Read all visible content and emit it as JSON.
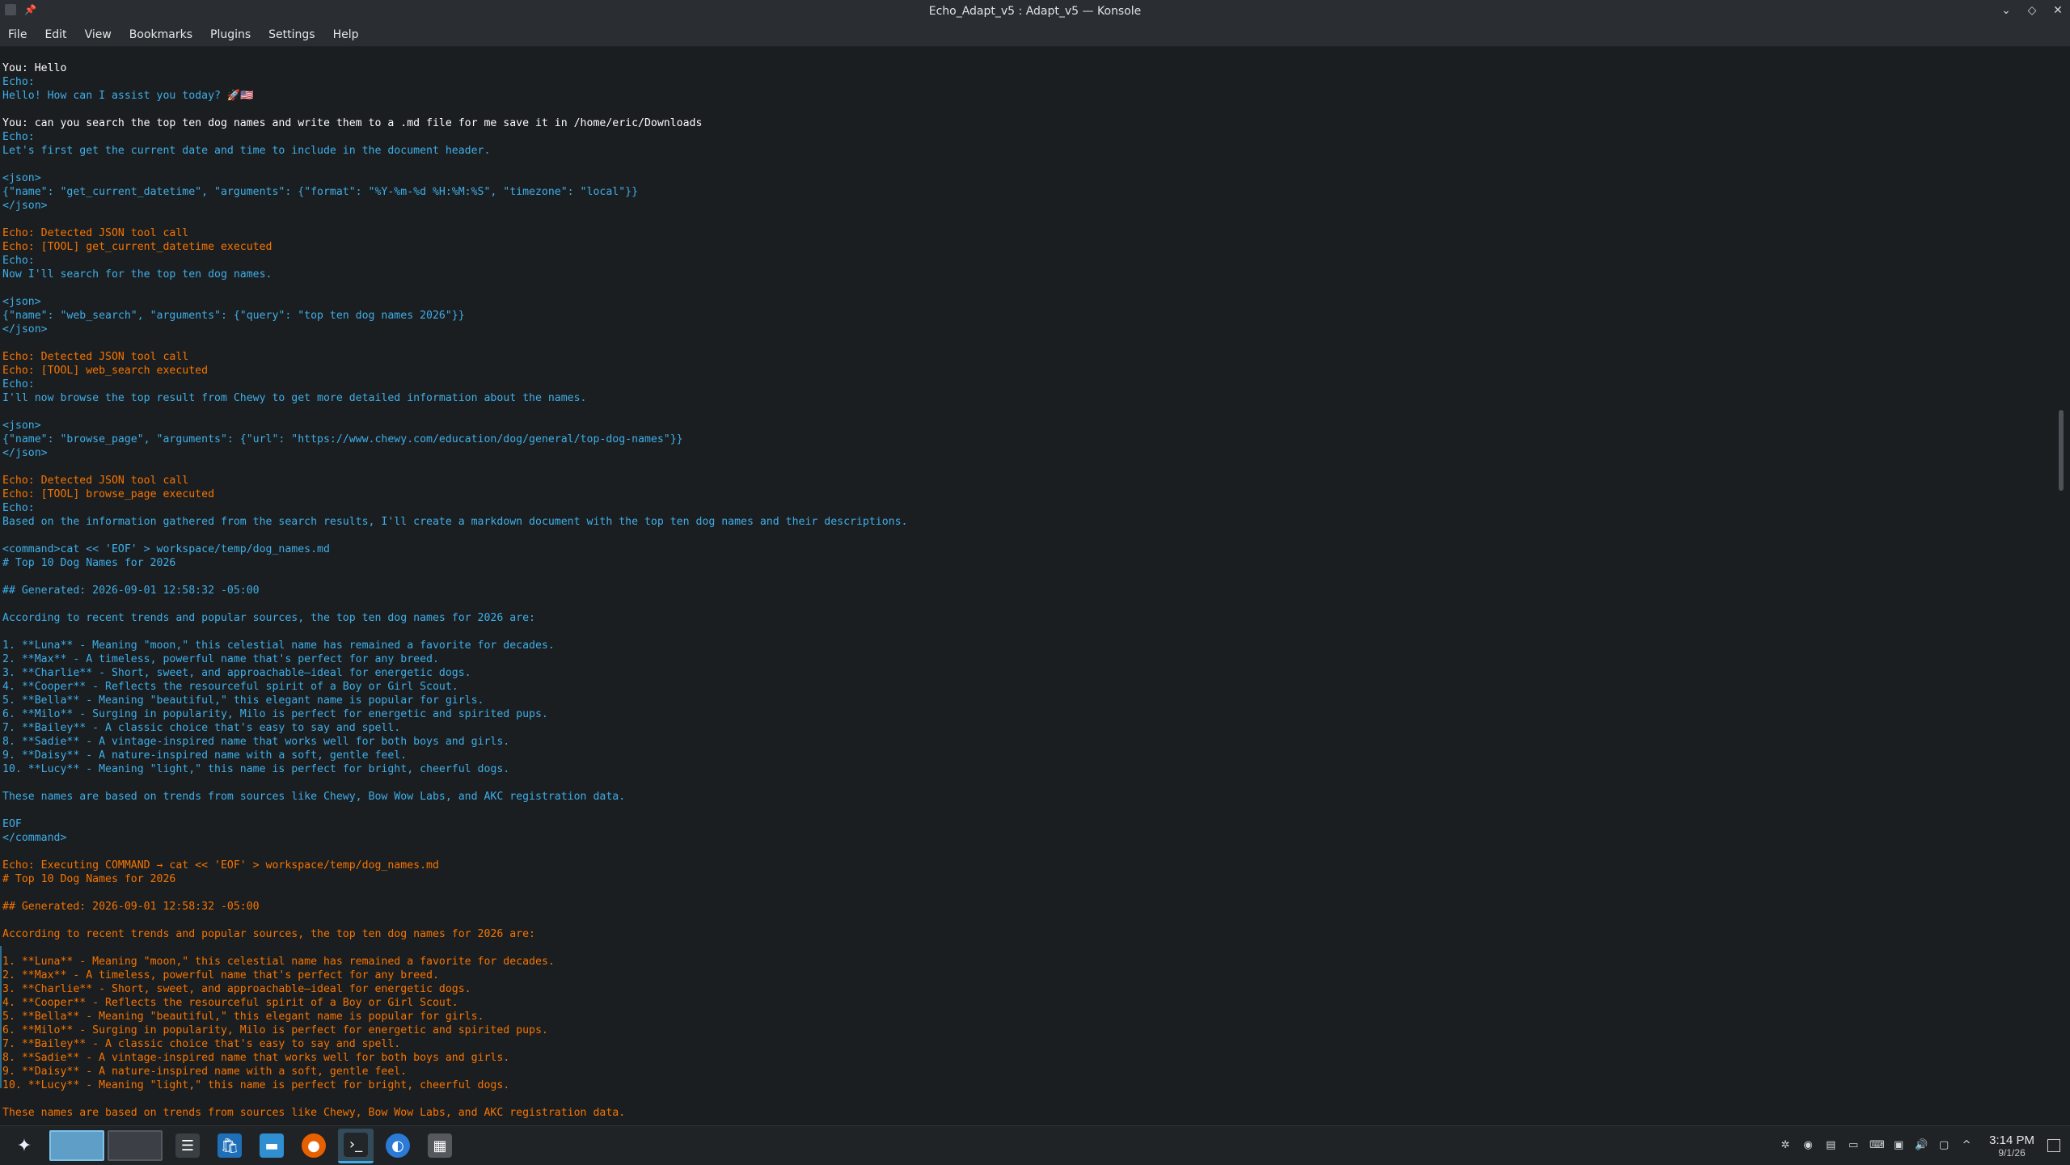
{
  "window": {
    "title": "Echo_Adapt_v5 : Adapt_v5 — Konsole"
  },
  "menu": [
    "File",
    "Edit",
    "View",
    "Bookmarks",
    "Plugins",
    "Settings",
    "Help"
  ],
  "terminal_lines": [
    {
      "c": "w",
      "t": ""
    },
    {
      "c": "w",
      "t": "You: Hello"
    },
    {
      "c": "b",
      "t": "Echo:"
    },
    {
      "c": "b",
      "t": "Hello! How can I assist you today? 🚀🇺🇸"
    },
    {
      "c": "w",
      "t": ""
    },
    {
      "c": "w",
      "t": "You: can you search the top ten dog names and write them to a .md file for me save it in /home/eric/Downloads"
    },
    {
      "c": "b",
      "t": "Echo:"
    },
    {
      "c": "b",
      "t": "Let's first get the current date and time to include in the document header."
    },
    {
      "c": "w",
      "t": ""
    },
    {
      "c": "b",
      "t": "<json>"
    },
    {
      "c": "b",
      "t": "{\"name\": \"get_current_datetime\", \"arguments\": {\"format\": \"%Y-%m-%d %H:%M:%S\", \"timezone\": \"local\"}}"
    },
    {
      "c": "b",
      "t": "</json>"
    },
    {
      "c": "w",
      "t": ""
    },
    {
      "c": "o",
      "t": "Echo: Detected JSON tool call"
    },
    {
      "c": "o",
      "t": "Echo: [TOOL] get_current_datetime executed"
    },
    {
      "c": "b",
      "t": "Echo:"
    },
    {
      "c": "b",
      "t": "Now I'll search for the top ten dog names."
    },
    {
      "c": "w",
      "t": ""
    },
    {
      "c": "b",
      "t": "<json>"
    },
    {
      "c": "b",
      "t": "{\"name\": \"web_search\", \"arguments\": {\"query\": \"top ten dog names 2026\"}}"
    },
    {
      "c": "b",
      "t": "</json>"
    },
    {
      "c": "w",
      "t": ""
    },
    {
      "c": "o",
      "t": "Echo: Detected JSON tool call"
    },
    {
      "c": "o",
      "t": "Echo: [TOOL] web_search executed"
    },
    {
      "c": "b",
      "t": "Echo:"
    },
    {
      "c": "b",
      "t": "I'll now browse the top result from Chewy to get more detailed information about the names."
    },
    {
      "c": "w",
      "t": ""
    },
    {
      "c": "b",
      "t": "<json>"
    },
    {
      "c": "b",
      "t": "{\"name\": \"browse_page\", \"arguments\": {\"url\": \"https://www.chewy.com/education/dog/general/top-dog-names\"}}"
    },
    {
      "c": "b",
      "t": "</json>"
    },
    {
      "c": "w",
      "t": ""
    },
    {
      "c": "o",
      "t": "Echo: Detected JSON tool call"
    },
    {
      "c": "o",
      "t": "Echo: [TOOL] browse_page executed"
    },
    {
      "c": "b",
      "t": "Echo:"
    },
    {
      "c": "b",
      "t": "Based on the information gathered from the search results, I'll create a markdown document with the top ten dog names and their descriptions."
    },
    {
      "c": "w",
      "t": ""
    },
    {
      "c": "b",
      "t": "<command>cat << 'EOF' > workspace/temp/dog_names.md"
    },
    {
      "c": "b",
      "t": "# Top 10 Dog Names for 2026"
    },
    {
      "c": "w",
      "t": ""
    },
    {
      "c": "b",
      "t": "## Generated: 2026-09-01 12:58:32 -05:00"
    },
    {
      "c": "w",
      "t": ""
    },
    {
      "c": "b",
      "t": "According to recent trends and popular sources, the top ten dog names for 2026 are:"
    },
    {
      "c": "w",
      "t": ""
    },
    {
      "c": "b",
      "t": "1. **Luna** - Meaning \"moon,\" this celestial name has remained a favorite for decades."
    },
    {
      "c": "b",
      "t": "2. **Max** - A timeless, powerful name that's perfect for any breed."
    },
    {
      "c": "b",
      "t": "3. **Charlie** - Short, sweet, and approachable—ideal for energetic dogs."
    },
    {
      "c": "b",
      "t": "4. **Cooper** - Reflects the resourceful spirit of a Boy or Girl Scout."
    },
    {
      "c": "b",
      "t": "5. **Bella** - Meaning \"beautiful,\" this elegant name is popular for girls."
    },
    {
      "c": "b",
      "t": "6. **Milo** - Surging in popularity, Milo is perfect for energetic and spirited pups."
    },
    {
      "c": "b",
      "t": "7. **Bailey** - A classic choice that's easy to say and spell."
    },
    {
      "c": "b",
      "t": "8. **Sadie** - A vintage-inspired name that works well for both boys and girls."
    },
    {
      "c": "b",
      "t": "9. **Daisy** - A nature-inspired name with a soft, gentle feel."
    },
    {
      "c": "b",
      "t": "10. **Lucy** - Meaning \"light,\" this name is perfect for bright, cheerful dogs."
    },
    {
      "c": "w",
      "t": ""
    },
    {
      "c": "b",
      "t": "These names are based on trends from sources like Chewy, Bow Wow Labs, and AKC registration data."
    },
    {
      "c": "w",
      "t": ""
    },
    {
      "c": "b",
      "t": "EOF"
    },
    {
      "c": "b",
      "t": "</command>"
    },
    {
      "c": "w",
      "t": ""
    },
    {
      "c": "o",
      "t": "Echo: Executing COMMAND → cat << 'EOF' > workspace/temp/dog_names.md"
    },
    {
      "c": "o",
      "t": "# Top 10 Dog Names for 2026"
    },
    {
      "c": "w",
      "t": ""
    },
    {
      "c": "o",
      "t": "## Generated: 2026-09-01 12:58:32 -05:00"
    },
    {
      "c": "w",
      "t": ""
    },
    {
      "c": "o",
      "t": "According to recent trends and popular sources, the top ten dog names for 2026 are:"
    },
    {
      "c": "w",
      "t": ""
    },
    {
      "c": "o",
      "t": "1. **Luna** - Meaning \"moon,\" this celestial name has remained a favorite for decades."
    },
    {
      "c": "o",
      "t": "2. **Max** - A timeless, powerful name that's perfect for any breed."
    },
    {
      "c": "o",
      "t": "3. **Charlie** - Short, sweet, and approachable—ideal for energetic dogs."
    },
    {
      "c": "o",
      "t": "4. **Cooper** - Reflects the resourceful spirit of a Boy or Girl Scout."
    },
    {
      "c": "o",
      "t": "5. **Bella** - Meaning \"beautiful,\" this elegant name is popular for girls."
    },
    {
      "c": "o",
      "t": "6. **Milo** - Surging in popularity, Milo is perfect for energetic and spirited pups."
    },
    {
      "c": "o",
      "t": "7. **Bailey** - A classic choice that's easy to say and spell."
    },
    {
      "c": "o",
      "t": "8. **Sadie** - A vintage-inspired name that works well for both boys and girls."
    },
    {
      "c": "o",
      "t": "9. **Daisy** - A nature-inspired name with a soft, gentle feel."
    },
    {
      "c": "o",
      "t": "10. **Lucy** - Meaning \"light,\" this name is perfect for bright, cheerful dogs."
    },
    {
      "c": "w",
      "t": ""
    },
    {
      "c": "o",
      "t": "These names are based on trends from sources like Chewy, Bow Wow Labs, and AKC registration data."
    }
  ],
  "taskbar": {
    "launcher_icon": "kde-launcher-icon",
    "tasks": [
      "system-settings-icon",
      "discover-store-icon",
      "dolphin-files-icon",
      "firefox-icon",
      "konsole-icon",
      "web-browser-icon",
      "calculator-icon"
    ]
  },
  "tray": {
    "icons": [
      "bug-icon",
      "circle-app-icon",
      "clipboard-icon",
      "battery-icon",
      "keyboard-icon",
      "image-icon",
      "volume-icon",
      "display-icon",
      "expand-tray-icon"
    ],
    "time": "3:14 PM",
    "date": "9/1/26"
  },
  "colors": {
    "user": "#fcfcfc",
    "echo": "#3daee9",
    "tool": "#f67400",
    "background": "#1b1e20"
  }
}
